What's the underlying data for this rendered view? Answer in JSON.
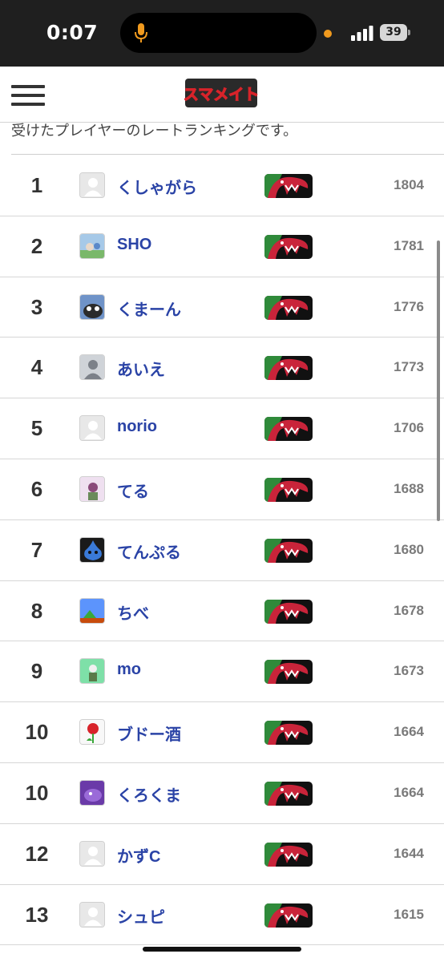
{
  "status_bar": {
    "time": "0:07",
    "battery": "39",
    "icons": [
      "microphone-icon",
      "privacy-dot",
      "cellular-signal-icon",
      "battery-icon"
    ],
    "accent": "#f09a1e"
  },
  "header": {
    "menu_icon": "hamburger-menu-icon",
    "logo_text": "スマメイト"
  },
  "subtitle": "受けたプレイヤーのレートランキングです。",
  "colors": {
    "link": "#2a43a6",
    "rating": "#7a7a7a",
    "logo_red": "#d8232a"
  },
  "rankings": [
    {
      "rank": "1",
      "name": "くしゃがら",
      "rating": "1804",
      "avatar": "default-avatar-icon",
      "fighter": "piranha-plant-icon"
    },
    {
      "rank": "2",
      "name": "SHO",
      "rating": "1781",
      "avatar": "game-scene-avatar",
      "fighter": "piranha-plant-icon"
    },
    {
      "rank": "3",
      "name": "くまーん",
      "rating": "1776",
      "avatar": "bear-avatar",
      "fighter": "piranha-plant-icon"
    },
    {
      "rank": "4",
      "name": "あいえ",
      "rating": "1773",
      "avatar": "person-silhouette-avatar",
      "fighter": "piranha-plant-icon"
    },
    {
      "rank": "5",
      "name": "norio",
      "rating": "1706",
      "avatar": "default-avatar-icon",
      "fighter": "piranha-plant-icon"
    },
    {
      "rank": "6",
      "name": "てる",
      "rating": "1688",
      "avatar": "character-avatar",
      "fighter": "piranha-plant-icon"
    },
    {
      "rank": "7",
      "name": "てんぷる",
      "rating": "1680",
      "avatar": "slime-avatar",
      "fighter": "piranha-plant-icon"
    },
    {
      "rank": "8",
      "name": "ちべ",
      "rating": "1678",
      "avatar": "pixel-landscape-avatar",
      "fighter": "piranha-plant-icon"
    },
    {
      "rank": "9",
      "name": "mo",
      "rating": "1673",
      "avatar": "green-character-avatar",
      "fighter": "piranha-plant-icon"
    },
    {
      "rank": "10",
      "name": "ブドー酒",
      "rating": "1664",
      "avatar": "piranha-plant-avatar",
      "fighter": "piranha-plant-icon"
    },
    {
      "rank": "10",
      "name": "くろくま",
      "rating": "1664",
      "avatar": "purple-character-avatar",
      "fighter": "piranha-plant-icon"
    },
    {
      "rank": "12",
      "name": "かずC",
      "rating": "1644",
      "avatar": "default-avatar-icon",
      "fighter": "piranha-plant-icon"
    },
    {
      "rank": "13",
      "name": "シュピ",
      "rating": "1615",
      "avatar": "default-avatar-icon",
      "fighter": "piranha-plant-icon"
    }
  ]
}
